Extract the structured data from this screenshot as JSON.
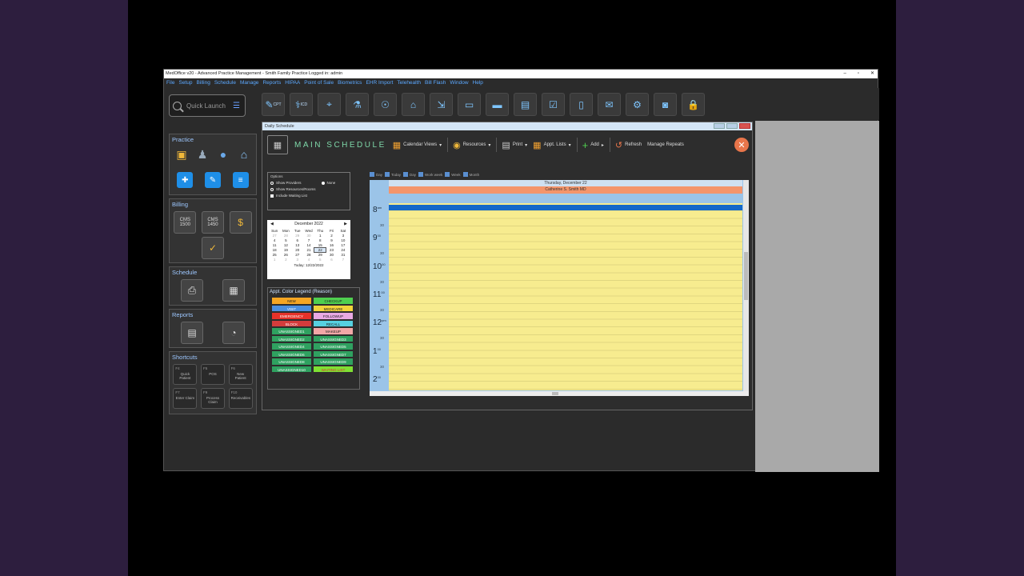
{
  "window": {
    "title": "MedOffice v20 - Advanced Practice Management - Smith Family Practice  Logged in: admin",
    "controls": [
      "–",
      "▫",
      "✕"
    ]
  },
  "menu": [
    "File",
    "Setup",
    "Billing",
    "Schedule",
    "Manage",
    "Reports",
    "HIPAA",
    "Point of Sale",
    "Biometrics",
    "EHR Import",
    "Telehealth",
    "Bill Flash",
    "Window",
    "Help"
  ],
  "quick_launch": {
    "placeholder": "Quick Launch"
  },
  "toolbar_icons": [
    {
      "name": "cpt-icon",
      "label": "CPT"
    },
    {
      "name": "icd-icon",
      "label": "ICD"
    },
    {
      "name": "location-icon",
      "label": ""
    },
    {
      "name": "microscope-icon",
      "label": ""
    },
    {
      "name": "patient-search-icon",
      "label": ""
    },
    {
      "name": "bank-icon",
      "label": ""
    },
    {
      "name": "import-icon",
      "label": ""
    },
    {
      "name": "monitor-icon",
      "label": ""
    },
    {
      "name": "card-icon",
      "label": ""
    },
    {
      "name": "id-card-icon",
      "label": ""
    },
    {
      "name": "checklist-icon",
      "label": ""
    },
    {
      "name": "phone-icon",
      "label": ""
    },
    {
      "name": "chat-icon",
      "label": ""
    },
    {
      "name": "user-settings-icon",
      "label": ""
    },
    {
      "name": "safe-icon",
      "label": ""
    },
    {
      "name": "lock-icon",
      "label": ""
    }
  ],
  "sidebar": {
    "practice": {
      "title": "Practice"
    },
    "billing": {
      "title": "Billing",
      "items": [
        "CMS 1500",
        "CMS 1450"
      ]
    },
    "schedule": {
      "title": "Schedule"
    },
    "reports": {
      "title": "Reports"
    },
    "shortcuts": {
      "title": "Shortcuts",
      "items": [
        {
          "key": "F4",
          "label": "Quick Patient"
        },
        {
          "key": "F5",
          "label": "POS"
        },
        {
          "key": "F6",
          "label": "New Patient"
        },
        {
          "key": "F7",
          "label": "Enter Claim"
        },
        {
          "key": "F9",
          "label": "Process Claim"
        },
        {
          "key": "F10",
          "label": "Receivables"
        }
      ]
    }
  },
  "schedule_window": {
    "title": "Daily Schedule",
    "header": "MAIN SCHEDULE",
    "tools": {
      "calendar_views": "Calendar Views",
      "resources": "Resources",
      "print": "Print",
      "appt_lists": "Appt. Lists",
      "add": "Add",
      "refresh": "Refresh",
      "manage_repeats": "Manage Repeats"
    },
    "options": {
      "title": "Options",
      "show_providers": "Show Providers",
      "none": "None",
      "show_resources": "Show Resources/Rooms",
      "include_waiting": "Include Waiting List"
    },
    "view_tabs": [
      "Day",
      "Today",
      "Day",
      "Work week",
      "Week",
      "Month"
    ],
    "calendar": {
      "month": "December 2022",
      "prev": "◀",
      "next": "▶",
      "weekdays": [
        "Sun",
        "Mon",
        "Tue",
        "Wed",
        "Thu",
        "Fri",
        "Sat"
      ],
      "days": [
        "27",
        "28",
        "29",
        "30",
        "1",
        "2",
        "3",
        "4",
        "5",
        "6",
        "7",
        "8",
        "9",
        "10",
        "11",
        "12",
        "13",
        "14",
        "15",
        "16",
        "17",
        "18",
        "19",
        "20",
        "21",
        "22",
        "23",
        "24",
        "25",
        "26",
        "27",
        "28",
        "29",
        "30",
        "31",
        "1",
        "2",
        "3",
        "4",
        "5",
        "6",
        "7"
      ],
      "today": "Today: 12/22/2022"
    },
    "legend": {
      "title": "Appt. Color Legend (Reason)",
      "items": [
        {
          "label": "NEW",
          "color": "#f5a623"
        },
        {
          "label": "CHECKUP",
          "color": "#4fcf4f"
        },
        {
          "label": "VISIT",
          "color": "#4a8fe0"
        },
        {
          "label": "MEDICARE",
          "color": "#f2d43a"
        },
        {
          "label": "EMERGENCY",
          "color": "#e5322a"
        },
        {
          "label": "FOLLOWUP",
          "color": "#e9a9e3"
        },
        {
          "label": "BLOCK",
          "color": "#d33c3c"
        },
        {
          "label": "RECALL",
          "color": "#56d0e0"
        },
        {
          "label": "UNASSIGNED1",
          "color": "#2fa160"
        },
        {
          "label": "MAKEUP",
          "color": "#f2a7a7"
        },
        {
          "label": "UNASSIGNED2",
          "color": "#2fa160"
        },
        {
          "label": "UNASSIGNED3",
          "color": "#2fa160"
        },
        {
          "label": "UNASSIGNED4",
          "color": "#2fa160"
        },
        {
          "label": "UNASSIGNED5",
          "color": "#2fa160"
        },
        {
          "label": "UNASSIGNED6",
          "color": "#2fa160"
        },
        {
          "label": "UNASSIGNED7",
          "color": "#2fa160"
        },
        {
          "label": "UNASSIGNED8",
          "color": "#2fa160"
        },
        {
          "label": "UNASSIGNED9",
          "color": "#2fa160"
        },
        {
          "label": "UNASSIGNED10",
          "color": "#2fa160"
        },
        {
          "label": "WAITING LIST",
          "color": "#7fe033"
        }
      ]
    },
    "day_view": {
      "date": "Thursday, December 22",
      "provider": "Catherine S. Smith MD",
      "hours": [
        {
          "hour": "8",
          "suffix": "am"
        },
        {
          "hour": "9",
          "suffix": "00"
        },
        {
          "hour": "10",
          "suffix": "00"
        },
        {
          "hour": "11",
          "suffix": "00"
        },
        {
          "hour": "12",
          "suffix": "pm"
        },
        {
          "hour": "1",
          "suffix": "00"
        },
        {
          "hour": "2",
          "suffix": "00"
        }
      ],
      "half": "30"
    }
  }
}
